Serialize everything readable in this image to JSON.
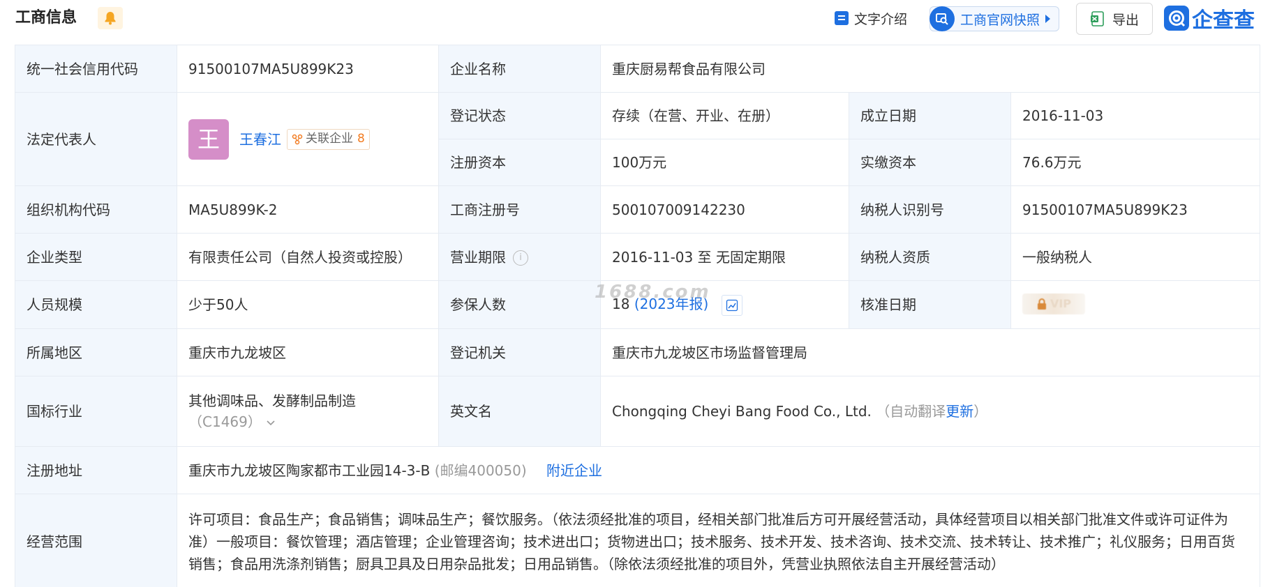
{
  "header": {
    "title": "工商信息",
    "btn_intro": "文字介绍",
    "btn_snapshot": "工商官网快照",
    "btn_export": "导出",
    "logo_text": "企查查"
  },
  "colors": {
    "accent": "#1e6fe0",
    "label_bg": "#f2f7fd",
    "link": "#1e6fe0",
    "badge_count": "#f27c22",
    "avatar": "#d58ec8"
  },
  "icons": [
    "bell-icon",
    "doc-icon",
    "search-snapshot-icon",
    "excel-icon",
    "qcc-logo-icon",
    "relation-icon",
    "info-icon",
    "chart-icon",
    "lock-icon"
  ],
  "watermark": "1688.com",
  "rows": {
    "credit_code": {
      "label": "统一社会信用代码",
      "value": "91500107MA5U899K23"
    },
    "company_name": {
      "label": "企业名称",
      "value": "重庆厨易帮食品有限公司"
    },
    "legal_rep": {
      "label": "法定代表人",
      "avatar_char": "王",
      "name": "王春江",
      "related_label": "关联企业",
      "related_count": "8"
    },
    "reg_status": {
      "label": "登记状态",
      "value": "存续（在营、开业、在册）"
    },
    "found_date": {
      "label": "成立日期",
      "value": "2016-11-03"
    },
    "reg_capital": {
      "label": "注册资本",
      "value": "100万元"
    },
    "paid_capital": {
      "label": "实缴资本",
      "value": "76.6万元"
    },
    "org_code": {
      "label": "组织机构代码",
      "value": "MA5U899K-2"
    },
    "reg_no": {
      "label": "工商注册号",
      "value": "500107009142230"
    },
    "taxpayer_id": {
      "label": "纳税人识别号",
      "value": "91500107MA5U899K23"
    },
    "company_type": {
      "label": "企业类型",
      "value": "有限责任公司（自然人投资或控股）"
    },
    "biz_term": {
      "label": "营业期限",
      "value": "2016-11-03 至 无固定期限"
    },
    "taxpayer_qual": {
      "label": "纳税人资质",
      "value": "一般纳税人"
    },
    "staff_size": {
      "label": "人员规模",
      "value": "少于50人"
    },
    "insured": {
      "label": "参保人数",
      "value": "18",
      "report": "(2023年报)"
    },
    "approve_date": {
      "label": "核准日期",
      "vip": "VIP"
    },
    "region": {
      "label": "所属地区",
      "value": "重庆市九龙坡区"
    },
    "reg_authority": {
      "label": "登记机关",
      "value": "重庆市九龙坡区市场监督管理局"
    },
    "industry": {
      "label": "国标行业",
      "value": "其他调味品、发酵制品制造",
      "code": "（C1469）"
    },
    "english_name": {
      "label": "英文名",
      "value": "Chongqing Cheyi Bang Food Co., Ltd.",
      "auto_prefix": "（自动翻译",
      "update": "更新",
      "auto_suffix": "）"
    },
    "address": {
      "label": "注册地址",
      "value": "重庆市九龙坡区陶家都市工业园14-3-B",
      "postcode": "(邮编400050)",
      "nearby": "附近企业"
    },
    "scope": {
      "label": "经营范围",
      "value": "许可项目：食品生产；食品销售；调味品生产；餐饮服务。（依法须经批准的项目，经相关部门批准后方可开展经营活动，具体经营项目以相关部门批准文件或许可证件为准）一般项目：餐饮管理；酒店管理；企业管理咨询；技术进出口；货物进出口；技术服务、技术开发、技术咨询、技术交流、技术转让、技术推广；礼仪服务；日用百货销售；食品用洗涤剂销售；厨具卫具及日用杂品批发；日用品销售。（除依法须经批准的项目外，凭营业执照依法自主开展经营活动）"
    }
  }
}
